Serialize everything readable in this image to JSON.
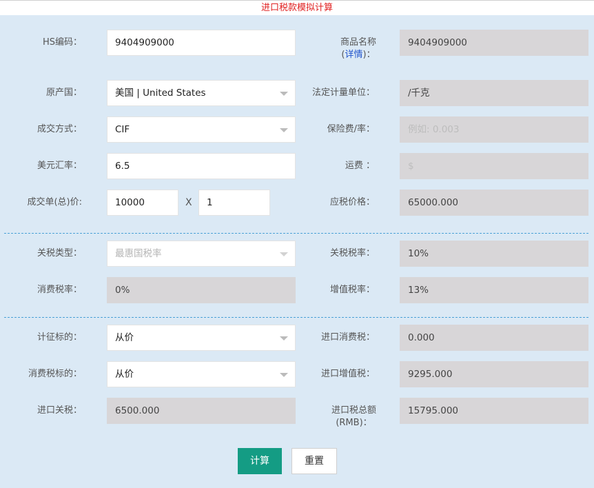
{
  "title": "进口税款模拟计算",
  "form": {
    "hs_code": {
      "label": "HS编码：",
      "value": "9404909000"
    },
    "product_name": {
      "label": "商品名称",
      "detail_link": "详情",
      "value": "9404909000"
    },
    "origin": {
      "label": "原产国：",
      "value": "美国 | United States"
    },
    "legal_unit": {
      "label": "法定计量单位：",
      "value": "/千克"
    },
    "trade_terms": {
      "label": "成交方式：",
      "value": "CIF"
    },
    "insurance": {
      "label": "保险费/率：",
      "placeholder": "例如: 0.003"
    },
    "usd_rate": {
      "label": "美元汇率：",
      "value": "6.5"
    },
    "freight": {
      "label": "运费 ：",
      "placeholder": "$"
    },
    "unit_price": {
      "label": "成交单(总)价:",
      "price": "10000",
      "times": "X",
      "quantity": "1"
    },
    "taxable_price": {
      "label": "应税价格：",
      "value": "65000.000"
    },
    "tariff_type": {
      "label": "关税类型：",
      "value": "最惠国税率"
    },
    "tariff_rate": {
      "label": "关税税率：",
      "value": "10%"
    },
    "consumption_rate": {
      "label": "消费税率：",
      "value": "0%"
    },
    "vat_rate": {
      "label": "增值税率：",
      "value": "13%"
    },
    "tax_basis": {
      "label": "计征标的：",
      "value": "从价"
    },
    "import_consumption_tax": {
      "label": "进口消费税：",
      "value": "0.000"
    },
    "consumption_basis": {
      "label": "消费税标的：",
      "value": "从价"
    },
    "import_vat": {
      "label": "进口增值税：",
      "value": "9295.000"
    },
    "import_tariff": {
      "label": "进口关税：",
      "value": "6500.000"
    },
    "total_tax": {
      "label_line1": "进口税总额",
      "label_line2": "(RMB)：",
      "value": "15795.000"
    }
  },
  "buttons": {
    "calculate": "计算",
    "reset": "重置"
  },
  "colors": {
    "title": "#e02020",
    "background": "#dbe9f5",
    "primary_button": "#149c84",
    "divider": "#4aa0d6",
    "link": "#2255cc"
  }
}
